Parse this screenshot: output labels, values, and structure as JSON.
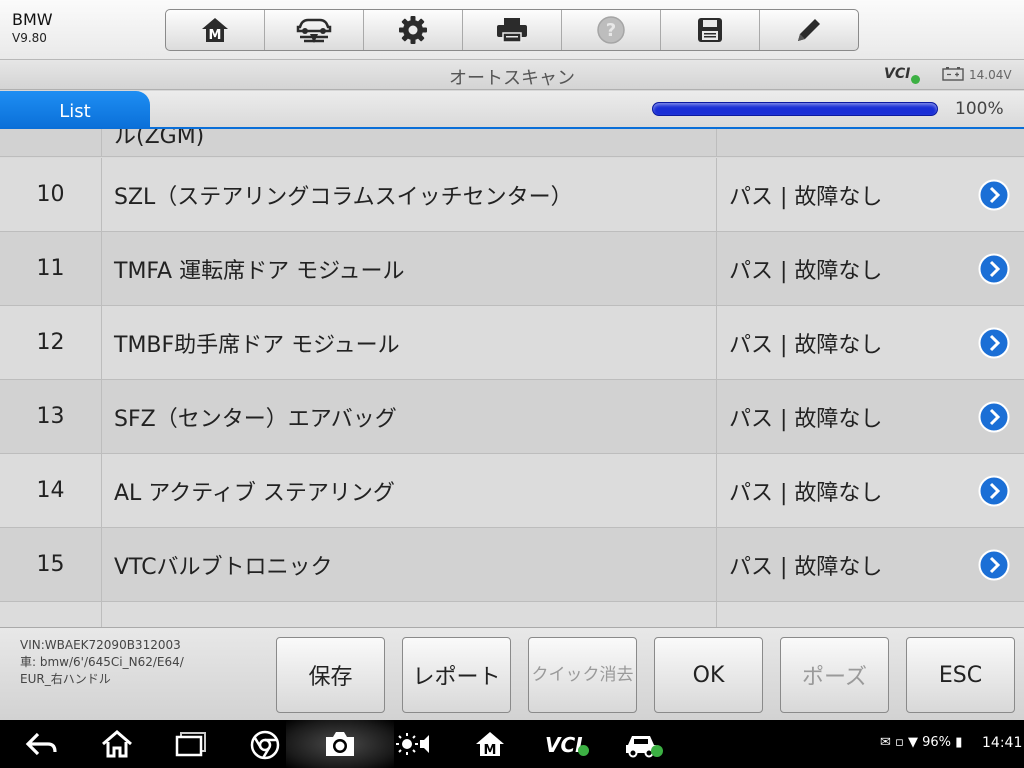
{
  "app": {
    "brand": "BMW",
    "version": "V9.80"
  },
  "toolbar": {
    "buttons": [
      {
        "name": "home",
        "icon": "m-home-icon"
      },
      {
        "name": "vehicle-swap",
        "icon": "car-swap-icon"
      },
      {
        "name": "settings",
        "icon": "gear-icon"
      },
      {
        "name": "print",
        "icon": "printer-icon"
      },
      {
        "name": "help",
        "icon": "help-icon"
      },
      {
        "name": "save",
        "icon": "floppy-icon"
      },
      {
        "name": "edit",
        "icon": "pencil-icon"
      }
    ]
  },
  "header": {
    "title": "オートスキャン",
    "vci": "VCI",
    "voltage": "14.04V"
  },
  "tabs": {
    "active": "List",
    "progress_percent": 100,
    "progress_label": "100%"
  },
  "rows": [
    {
      "num": "",
      "module": "ル(ZGM)",
      "result": "パス | 故障なし"
    },
    {
      "num": "10",
      "module": "SZL（ステアリングコラムスイッチセンター）",
      "result": "パス | 故障なし"
    },
    {
      "num": "11",
      "module": "TMFA 運転席ドア モジュール",
      "result": "パス | 故障なし"
    },
    {
      "num": "12",
      "module": "TMBF助手席ドア モジュール",
      "result": "パス | 故障なし"
    },
    {
      "num": "13",
      "module": "SFZ（センター）エアバッグ",
      "result": "パス | 故障なし"
    },
    {
      "num": "14",
      "module": "AL アクティブ ステアリング",
      "result": "パス | 故障なし"
    },
    {
      "num": "15",
      "module": "VTCバルブトロニック",
      "result": "パス | 故障なし"
    },
    {
      "num": "",
      "module": "",
      "result": ""
    }
  ],
  "vehicle_info": {
    "vin": "VIN:WBAEK72090B312003",
    "car_line1": "車: bmw/6'/645Ci_N62/E64/",
    "car_line2": "EUR_右ハンドル"
  },
  "actions": [
    {
      "name": "save-button",
      "label": "保存",
      "enabled": true
    },
    {
      "name": "report-button",
      "label": "レポート",
      "enabled": true
    },
    {
      "name": "quick-erase-button",
      "label": "クイック消去",
      "enabled": false
    },
    {
      "name": "ok-button",
      "label": "OK",
      "enabled": true
    },
    {
      "name": "pause-button",
      "label": "ポーズ",
      "enabled": false
    },
    {
      "name": "esc-button",
      "label": "ESC",
      "enabled": true
    }
  ],
  "system": {
    "battery": "96%",
    "time": "14:41"
  },
  "colors": {
    "accent": "#0a6fd8",
    "progress": "#1a2fd6",
    "arrow": "#1b6fd6"
  }
}
